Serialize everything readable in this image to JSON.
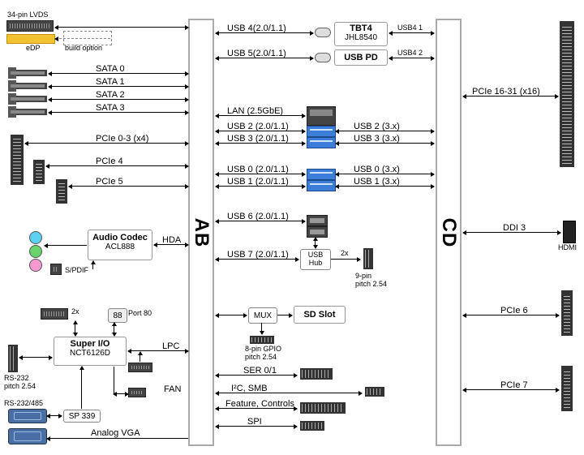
{
  "chips": {
    "ab": "AB",
    "cd": "CD"
  },
  "left": {
    "lvds": "34-pin LVDS",
    "edp": "eDP",
    "build_option": "build option",
    "sata": [
      "SATA 0",
      "SATA 1",
      "SATA 2",
      "SATA 3"
    ],
    "pcie03": "PCIe 0-3 (x4)",
    "pcie4": "PCIe 4",
    "pcie5": "PCIe 5",
    "audio_title": "Audio Codec",
    "audio_sub": "ACL888",
    "hda": "HDA",
    "spdif": "S/PDIF",
    "superio_title": "Super I/O",
    "superio_sub": "NCT6126D",
    "port80": "Port 80",
    "lpc": "LPC",
    "fan": "FAN",
    "twox": "2x",
    "rs232_hdr": "RS-232\npitch 2.54",
    "rs232485": "RS-232/485",
    "sp339": "SP 339",
    "analog_vga": "Analog VGA"
  },
  "center": {
    "usb4": "USB 4(2.0/1.1)",
    "usb5": "USB 5(2.0/1.1)",
    "lan": "LAN (2.5GbE)",
    "usb2": "USB 2 (2.0/1.1)",
    "usb3": "USB 3 (2.0/1.1)",
    "usb0": "USB 0 (2.0/1.1)",
    "usb1": "USB 1 (2.0/1.1)",
    "usb6": "USB 6 (2.0/1.1)",
    "usb7": "USB 7 (2.0/1.1)",
    "usbhub": "USB Hub",
    "hub2x": "2x",
    "ninepin": "9-pin\npitch 2.54",
    "mux": "MUX",
    "sdslot": "SD Slot",
    "gpio": "8-pin GPIO\npitch 2.54",
    "ser01": "SER 0/1",
    "i2c": "I²C, SMB",
    "feat": "Feature, Controls",
    "spi": "SPI"
  },
  "tbt": {
    "title": "TBT4",
    "sub": "JHL8540",
    "usbpd": "USB PD",
    "usb41": "USB4 1",
    "usb42": "USB4 2"
  },
  "right": {
    "pcie16": "PCIe 16-31 (x16)",
    "usb2_3x": "USB 2 (3.x)",
    "usb3_3x": "USB 3 (3.x)",
    "usb0_3x": "USB 0 (3.x)",
    "usb1_3x": "USB 1 (3.x)",
    "ddi3": "DDI 3",
    "hdmi": "HDMI",
    "pcie6": "PCIe 6",
    "pcie7": "PCIe 7"
  }
}
